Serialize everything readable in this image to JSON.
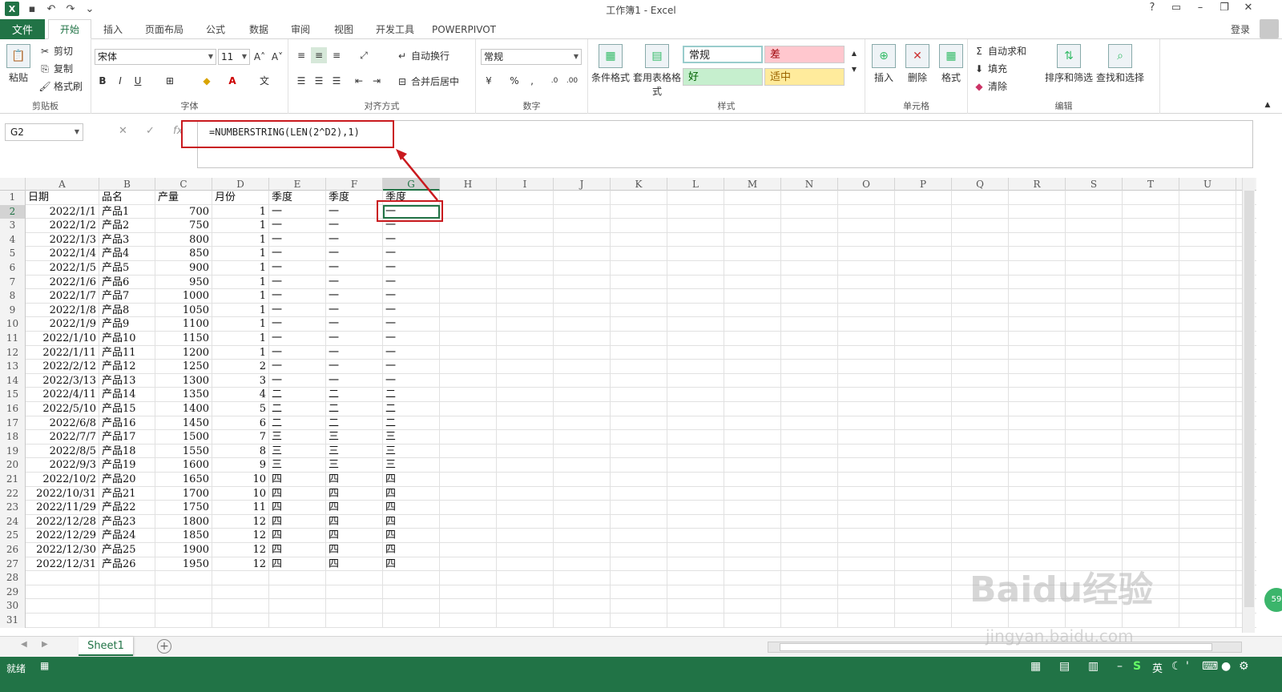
{
  "title": "工作簿1 - Excel",
  "login": "登录",
  "tabs": [
    "文件",
    "开始",
    "插入",
    "页面布局",
    "公式",
    "数据",
    "审阅",
    "视图",
    "开发工具",
    "POWERPIVOT"
  ],
  "ribbon": {
    "clipboard": {
      "paste": "粘贴",
      "cut": "剪切",
      "copy": "复制",
      "format_painter": "格式刷",
      "label": "剪贴板"
    },
    "font": {
      "name": "宋体",
      "size": "11",
      "label": "字体"
    },
    "alignment": {
      "wrap": "自动换行",
      "merge": "合并后居中",
      "label": "对齐方式"
    },
    "number": {
      "format": "常规",
      "label": "数字"
    },
    "styles": {
      "cond": "条件格式",
      "table": "套用表格格式",
      "normal": "常规",
      "bad": "差",
      "good": "好",
      "neutral": "适中",
      "label": "样式"
    },
    "cells": {
      "insert": "插入",
      "delete": "删除",
      "format": "格式",
      "label": "单元格"
    },
    "editing": {
      "autosum": "自动求和",
      "fill": "填充",
      "clear": "清除",
      "sort": "排序和筛选",
      "find": "查找和选择",
      "label": "编辑"
    }
  },
  "namebox": "G2",
  "formula": "=NUMBERSTRING(LEN(2^D2),1)",
  "columns": [
    "A",
    "B",
    "C",
    "D",
    "E",
    "F",
    "G",
    "H",
    "I",
    "J",
    "K",
    "L",
    "M",
    "N",
    "O",
    "P",
    "Q",
    "R",
    "S",
    "T",
    "U"
  ],
  "headers": [
    "日期",
    "品名",
    "产量",
    "月份",
    "季度",
    "季度",
    "季度"
  ],
  "rows": [
    [
      "2022/1/1",
      "产品1",
      "700",
      "1",
      "一",
      "一",
      "一"
    ],
    [
      "2022/1/2",
      "产品2",
      "750",
      "1",
      "一",
      "一",
      "一"
    ],
    [
      "2022/1/3",
      "产品3",
      "800",
      "1",
      "一",
      "一",
      "一"
    ],
    [
      "2022/1/4",
      "产品4",
      "850",
      "1",
      "一",
      "一",
      "一"
    ],
    [
      "2022/1/5",
      "产品5",
      "900",
      "1",
      "一",
      "一",
      "一"
    ],
    [
      "2022/1/6",
      "产品6",
      "950",
      "1",
      "一",
      "一",
      "一"
    ],
    [
      "2022/1/7",
      "产品7",
      "1000",
      "1",
      "一",
      "一",
      "一"
    ],
    [
      "2022/1/8",
      "产品8",
      "1050",
      "1",
      "一",
      "一",
      "一"
    ],
    [
      "2022/1/9",
      "产品9",
      "1100",
      "1",
      "一",
      "一",
      "一"
    ],
    [
      "2022/1/10",
      "产品10",
      "1150",
      "1",
      "一",
      "一",
      "一"
    ],
    [
      "2022/1/11",
      "产品11",
      "1200",
      "1",
      "一",
      "一",
      "一"
    ],
    [
      "2022/2/12",
      "产品12",
      "1250",
      "2",
      "一",
      "一",
      "一"
    ],
    [
      "2022/3/13",
      "产品13",
      "1300",
      "3",
      "一",
      "一",
      "一"
    ],
    [
      "2022/4/11",
      "产品14",
      "1350",
      "4",
      "二",
      "二",
      "二"
    ],
    [
      "2022/5/10",
      "产品15",
      "1400",
      "5",
      "二",
      "二",
      "二"
    ],
    [
      "2022/6/8",
      "产品16",
      "1450",
      "6",
      "二",
      "二",
      "二"
    ],
    [
      "2022/7/7",
      "产品17",
      "1500",
      "7",
      "三",
      "三",
      "三"
    ],
    [
      "2022/8/5",
      "产品18",
      "1550",
      "8",
      "三",
      "三",
      "三"
    ],
    [
      "2022/9/3",
      "产品19",
      "1600",
      "9",
      "三",
      "三",
      "三"
    ],
    [
      "2022/10/2",
      "产品20",
      "1650",
      "10",
      "四",
      "四",
      "四"
    ],
    [
      "2022/10/31",
      "产品21",
      "1700",
      "10",
      "四",
      "四",
      "四"
    ],
    [
      "2022/11/29",
      "产品22",
      "1750",
      "11",
      "四",
      "四",
      "四"
    ],
    [
      "2022/12/28",
      "产品23",
      "1800",
      "12",
      "四",
      "四",
      "四"
    ],
    [
      "2022/12/29",
      "产品24",
      "1850",
      "12",
      "四",
      "四",
      "四"
    ],
    [
      "2022/12/30",
      "产品25",
      "1900",
      "12",
      "四",
      "四",
      "四"
    ],
    [
      "2022/12/31",
      "产品26",
      "1950",
      "12",
      "四",
      "四",
      "四"
    ]
  ],
  "sheet_tab": "Sheet1",
  "status": "就绪",
  "watermark": "Baidu经验",
  "watermark_sub": "jingyan.baidu.com",
  "badge": "59",
  "ime": "英"
}
